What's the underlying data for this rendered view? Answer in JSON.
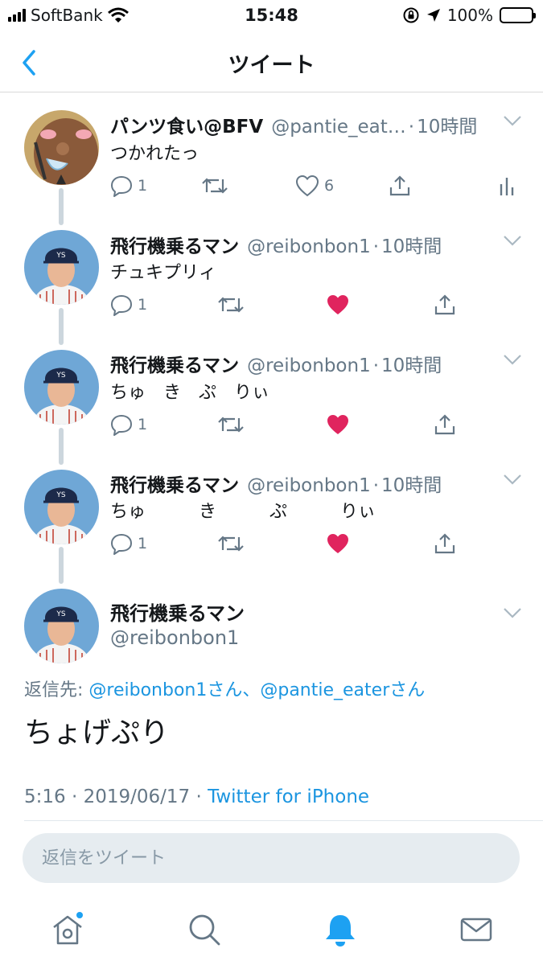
{
  "status_bar": {
    "carrier": "SoftBank",
    "time": "15:48",
    "battery": "100%"
  },
  "header": {
    "title": "ツイート",
    "back_icon": "chevron-left-icon"
  },
  "thread": [
    {
      "name": "パンツ食い@BFV",
      "handle": "@pantie_eat…",
      "sep": "·",
      "ago": "10時間",
      "text": "つかれたっ",
      "reply_count": "1",
      "like_count": "6",
      "liked": false
    },
    {
      "name": "飛行機乗るマン",
      "handle": "@reibonbon1",
      "sep": "·",
      "ago": "10時間",
      "text": "チュキプリィ",
      "reply_count": "1",
      "like_count": "",
      "liked": true
    },
    {
      "name": "飛行機乗るマン",
      "handle": "@reibonbon1",
      "sep": "·",
      "ago": "10時間",
      "text": "ちゅ　き　ぷ　りぃ",
      "reply_count": "1",
      "like_count": "",
      "liked": true
    },
    {
      "name": "飛行機乗るマン",
      "handle": "@reibonbon1",
      "sep": "·",
      "ago": "10時間",
      "text": "ちゅ　　　き　　　ぷ　　　りぃ",
      "reply_count": "1",
      "like_count": "",
      "liked": true
    }
  ],
  "main_tweet": {
    "name": "飛行機乗るマン",
    "handle": "@reibonbon1",
    "reply_to_label": "返信先: ",
    "reply_to_mentions": "@reibonbon1さん、@pantie_eaterさん",
    "text": "ちょげぷり",
    "time": "5:16 · 2019/06/17 · ",
    "source": "Twitter for iPhone"
  },
  "reply_box": {
    "placeholder": "返信をツイート"
  },
  "tabbar": {
    "items": [
      "home-icon",
      "search-icon",
      "notifications-icon",
      "messages-icon"
    ],
    "active": "notifications-icon",
    "home_badge": true
  },
  "colors": {
    "accent": "#1da1f2",
    "like": "#e0245e",
    "muted": "#657786",
    "thread_line": "#ccd6dd"
  }
}
